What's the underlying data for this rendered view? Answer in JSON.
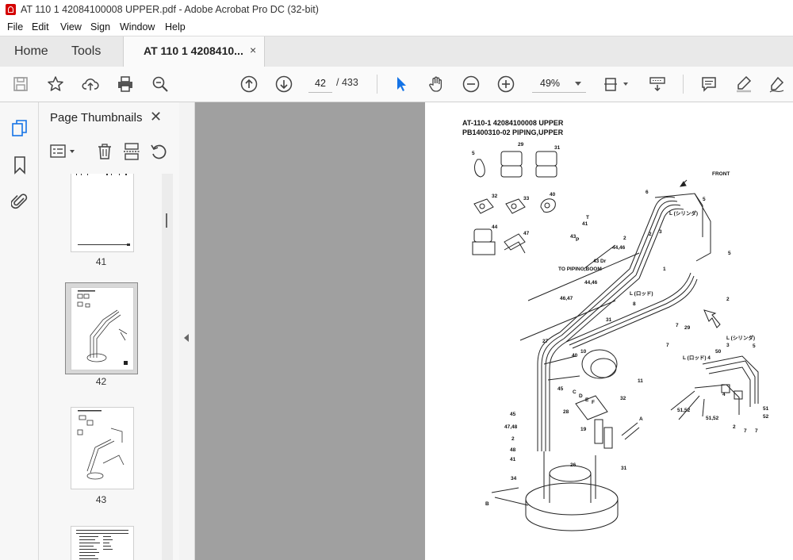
{
  "window": {
    "title": "AT 110 1 42084100008 UPPER.pdf - Adobe Acrobat Pro DC (32-bit)"
  },
  "menu": [
    "File",
    "Edit",
    "View",
    "Sign",
    "Window",
    "Help"
  ],
  "tabs": {
    "home": "Home",
    "tools": "Tools",
    "document": "AT 110 1 4208410...",
    "close": "×"
  },
  "toolbar": {
    "current_page": "42",
    "page_total": "/ 433",
    "zoom": "49%"
  },
  "thumbnails_panel": {
    "title": "Page Thumbnails",
    "close": "✕",
    "pages": [
      {
        "number": "41",
        "selected": false
      },
      {
        "number": "42",
        "selected": true
      },
      {
        "number": "43",
        "selected": false
      }
    ]
  },
  "document": {
    "heading_line1": "AT-110-1 42084100008 UPPER",
    "heading_line2": "PB1400310-02 PIPING,UPPER",
    "labels": {
      "front": "FRONT",
      "to_piping_boom": "TO PIPING,BOOM",
      "l_cyl_upper": "L (シリンダ)",
      "l_rod": "L (ロッド)",
      "l_cyl_right": "L (シリンダ)",
      "l_rod_right": "L (ロッド) 4",
      "dr": "43 Dr",
      "p": "P",
      "t": "T",
      "a": "A",
      "b": "B",
      "c": "C",
      "d": "D",
      "e": "E",
      "f": "F",
      "n5": "5",
      "n29": "29",
      "n31": "31",
      "n32": "32",
      "n33": "33",
      "n40": "40",
      "n44": "44",
      "n47": "47",
      "n6": "6",
      "n3": "3",
      "n2": "2",
      "n1": "1",
      "n41": "41",
      "n43": "43",
      "n4446": "44,46",
      "n4646": "44,46",
      "n4647": "46,47",
      "n7": "7",
      "n8": "8",
      "n27": "27",
      "n10": "10",
      "n11": "11",
      "n45": "45",
      "n28": "28",
      "n19": "19",
      "n26": "26",
      "n34": "34",
      "n48": "48",
      "n4748": "47,48",
      "n4": "4",
      "n50": "50",
      "n5152": "51,52",
      "n51": "51",
      "n52": "52"
    }
  },
  "colors": {
    "accent_blue": "#1473e6",
    "pdf_red": "#d40000",
    "doc_background": "#a0a0a0"
  }
}
